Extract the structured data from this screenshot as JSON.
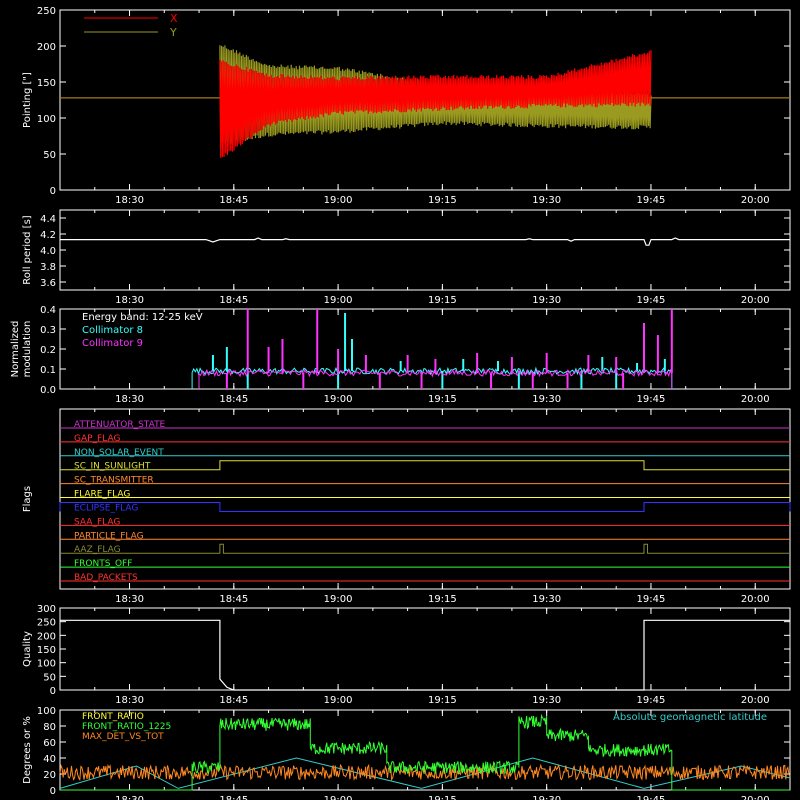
{
  "chart_data": [
    {
      "type": "line",
      "id": "pointing",
      "ylabel": "Pointing [\"]",
      "ylim": [
        0,
        250
      ],
      "yticks": [
        0,
        50,
        100,
        150,
        200,
        250
      ],
      "xlim": [
        "18:20",
        "20:05"
      ],
      "xticks": [
        "18:30",
        "18:45",
        "19:00",
        "19:15",
        "19:30",
        "19:45",
        "20:00"
      ],
      "series": [
        {
          "name": "X",
          "color": "#ff0000",
          "oscillation_start": "18:43",
          "oscillation_end": "19:45",
          "baseline": 128,
          "envelope": [
            {
              "time": "18:43",
              "low": 40,
              "high": 182
            },
            {
              "time": "18:50",
              "low": 88,
              "high": 162
            },
            {
              "time": "19:00",
              "low": 104,
              "high": 158
            },
            {
              "time": "19:15",
              "low": 110,
              "high": 160
            },
            {
              "time": "19:30",
              "low": 114,
              "high": 160
            },
            {
              "time": "19:45",
              "low": 116,
              "high": 195
            }
          ]
        },
        {
          "name": "Y",
          "color": "#9a9a20",
          "oscillation_start": "18:43",
          "oscillation_end": "19:45",
          "baseline": 128,
          "envelope": [
            {
              "time": "18:43",
              "low": 60,
              "high": 205
            },
            {
              "time": "18:50",
              "low": 74,
              "high": 175
            },
            {
              "time": "19:00",
              "low": 78,
              "high": 172
            },
            {
              "time": "19:15",
              "low": 90,
              "high": 148
            },
            {
              "time": "19:30",
              "low": 86,
              "high": 148
            },
            {
              "time": "19:45",
              "low": 84,
              "high": 135
            }
          ]
        }
      ]
    },
    {
      "type": "line",
      "id": "roll",
      "ylabel": "Roll period [s]",
      "ylim": [
        3.5,
        4.5
      ],
      "yticks": [
        3.6,
        3.8,
        4.0,
        4.2,
        4.4
      ],
      "yticklabels": [
        "3.6",
        "3.8",
        "4.0",
        "4.2",
        "4.4"
      ],
      "xticks": [
        "18:30",
        "18:45",
        "19:00",
        "19:15",
        "19:30",
        "19:45",
        "20:00"
      ],
      "series": [
        {
          "name": "",
          "color": "#ffffff",
          "points": [
            [
              "18:20",
              4.13
            ],
            [
              "18:41",
              4.13
            ],
            [
              "18:42",
              4.1
            ],
            [
              "18:43",
              4.13
            ],
            [
              "18:48",
              4.13
            ],
            [
              "18:48.5",
              4.15
            ],
            [
              "18:49",
              4.13
            ],
            [
              "18:52",
              4.13
            ],
            [
              "18:52.5",
              4.14
            ],
            [
              "18:53",
              4.13
            ],
            [
              "19:27",
              4.13
            ],
            [
              "19:27.5",
              4.14
            ],
            [
              "19:28",
              4.13
            ],
            [
              "19:33",
              4.13
            ],
            [
              "19:33.5",
              4.11
            ],
            [
              "19:34",
              4.13
            ],
            [
              "19:44",
              4.13
            ],
            [
              "19:44.3",
              4.06
            ],
            [
              "19:44.7",
              4.06
            ],
            [
              "19:45",
              4.13
            ],
            [
              "19:48",
              4.13
            ],
            [
              "19:48.5",
              4.15
            ],
            [
              "19:49",
              4.13
            ],
            [
              "20:05",
              4.13
            ]
          ]
        }
      ]
    },
    {
      "type": "line",
      "id": "modulation",
      "ylabel": "Normalized",
      "ylabel2": "modulation",
      "ylim": [
        0,
        0.4
      ],
      "yticks": [
        0.0,
        0.1,
        0.2,
        0.3,
        0.4
      ],
      "yticklabels": [
        "0.0",
        "0.1",
        "0.2",
        "0.3",
        "0.4"
      ],
      "xticks": [
        "18:30",
        "18:45",
        "19:00",
        "19:15",
        "19:30",
        "19:45",
        "20:00"
      ],
      "annotation": "Energy band: 12-25 keV",
      "series": [
        {
          "name": "Collimator 8",
          "color": "#33ffff",
          "start": "18:39",
          "end": "19:48",
          "base": 0.09,
          "spikes": [
            [
              "18:42",
              0.17
            ],
            [
              "18:44",
              0.21
            ],
            [
              "18:52",
              0.15
            ],
            [
              "19:01",
              0.38
            ],
            [
              "19:02",
              0.25
            ],
            [
              "19:09",
              0.14
            ],
            [
              "19:18",
              0.15
            ],
            [
              "19:23",
              0.14
            ],
            [
              "19:38",
              0.16
            ],
            [
              "19:43",
              0.13
            ],
            [
              "19:47",
              0.15
            ]
          ],
          "dips": [
            "18:47",
            "19:00",
            "19:15",
            "19:26",
            "19:35",
            "19:40"
          ]
        },
        {
          "name": "Collimator 9",
          "color": "#ff33ff",
          "start": "18:40",
          "end": "19:48",
          "base": 0.08,
          "spikes": [
            [
              "18:47",
              0.42
            ],
            [
              "18:50",
              0.21
            ],
            [
              "18:52",
              0.25
            ],
            [
              "18:57",
              0.42
            ],
            [
              "19:00",
              0.2
            ],
            [
              "19:04",
              0.17
            ],
            [
              "19:10",
              0.17
            ],
            [
              "19:14",
              0.15
            ],
            [
              "19:20",
              0.18
            ],
            [
              "19:25",
              0.16
            ],
            [
              "19:30",
              0.18
            ],
            [
              "19:36",
              0.17
            ],
            [
              "19:40",
              0.16
            ],
            [
              "19:44",
              0.33
            ],
            [
              "19:46",
              0.27
            ],
            [
              "19:48",
              0.42
            ]
          ],
          "dips": [
            "18:44",
            "18:55",
            "19:06",
            "19:12",
            "19:22",
            "19:28",
            "19:33",
            "19:41"
          ]
        }
      ]
    },
    {
      "type": "line",
      "id": "flags",
      "ylabel": "Flags",
      "xticks": [
        "18:30",
        "18:45",
        "19:00",
        "19:15",
        "19:30",
        "19:45",
        "20:00"
      ],
      "series": [
        {
          "name": "ATTENUATOR_STATE",
          "color": "#cc33cc",
          "states": []
        },
        {
          "name": "GAP_FLAG",
          "color": "#ff3333",
          "states": []
        },
        {
          "name": "NON_SOLAR_EVENT",
          "color": "#33cccc",
          "states": []
        },
        {
          "name": "SC_IN_SUNLIGHT",
          "color": "#dddd33",
          "states": [
            [
              "18:43",
              "19:44"
            ]
          ]
        },
        {
          "name": "SC_TRANSMITTER",
          "color": "#ff8833",
          "states": []
        },
        {
          "name": "FLARE_FLAG",
          "color": "#ffff33",
          "states": []
        },
        {
          "name": "ECLIPSE_FLAG",
          "color": "#3333ff",
          "states": [
            [
              "18:20",
              "18:43"
            ],
            [
              "19:44",
              "20:05"
            ]
          ]
        },
        {
          "name": "SAA_FLAG",
          "color": "#ff3333",
          "states": []
        },
        {
          "name": "PARTICLE_FLAG",
          "color": "#ff8833",
          "states": []
        },
        {
          "name": "AAZ_FLAG",
          "color": "#888833",
          "states": [
            [
              "18:43",
              "18:43.5"
            ],
            [
              "19:44",
              "19:44.5"
            ]
          ]
        },
        {
          "name": "FRONTS_OFF",
          "color": "#33ff33",
          "states": []
        },
        {
          "name": "BAD_PACKETS",
          "color": "#ff3333",
          "states": []
        }
      ]
    },
    {
      "type": "line",
      "id": "quality",
      "ylabel": "Quality",
      "ylim": [
        0,
        300
      ],
      "yticks": [
        0,
        50,
        100,
        150,
        200,
        250,
        300
      ],
      "xticks": [
        "18:30",
        "18:45",
        "19:00",
        "19:15",
        "19:30",
        "19:45",
        "20:00"
      ],
      "series": [
        {
          "name": "",
          "color": "#ffffff",
          "points": [
            [
              "18:20",
              255
            ],
            [
              "18:43",
              255
            ],
            [
              "18:43",
              40
            ],
            [
              "18:44",
              10
            ],
            [
              "18:45",
              0
            ],
            [
              "19:44",
              0
            ],
            [
              "19:44",
              255
            ],
            [
              "20:05",
              255
            ]
          ]
        }
      ]
    },
    {
      "type": "line",
      "id": "ratios",
      "ylabel": "Degrees or %",
      "ylim": [
        0,
        100
      ],
      "yticks": [
        0,
        20,
        40,
        60,
        80,
        100
      ],
      "xticks": [
        "18:30",
        "18:45",
        "19:00",
        "19:15",
        "19:30",
        "19:45",
        "20:00"
      ],
      "annotation": "Absolute geomagnetic latitude",
      "series": [
        {
          "name": "FRONT_RATIO",
          "color": "#ffff33",
          "points": []
        },
        {
          "name": "FRONT_RATIO_1225",
          "color": "#33ff33",
          "levels": [
            [
              "18:20",
              0
            ],
            [
              "18:39",
              0
            ],
            [
              "18:39",
              28
            ],
            [
              "18:43",
              28
            ],
            [
              "18:43",
              82
            ],
            [
              "18:56",
              82
            ],
            [
              "18:56",
              52
            ],
            [
              "19:07",
              52
            ],
            [
              "19:07",
              28
            ],
            [
              "19:26",
              28
            ],
            [
              "19:26",
              85
            ],
            [
              "19:30",
              85
            ],
            [
              "19:30",
              68
            ],
            [
              "19:36",
              68
            ],
            [
              "19:36",
              50
            ],
            [
              "19:48",
              50
            ],
            [
              "19:48",
              0
            ],
            [
              "20:05",
              0
            ]
          ]
        },
        {
          "name": "MAX_DET_VS_TOT",
          "color": "#ff8822",
          "base": 22
        },
        {
          "name": "",
          "color": "#33cccc",
          "points": [
            [
              "18:20",
              2
            ],
            [
              "18:31",
              30
            ],
            [
              "18:37",
              2
            ],
            [
              "18:54",
              40
            ],
            [
              "19:12",
              2
            ],
            [
              "19:28",
              40
            ],
            [
              "19:44",
              2
            ],
            [
              "19:58",
              30
            ],
            [
              "20:05",
              15
            ]
          ]
        }
      ]
    }
  ]
}
